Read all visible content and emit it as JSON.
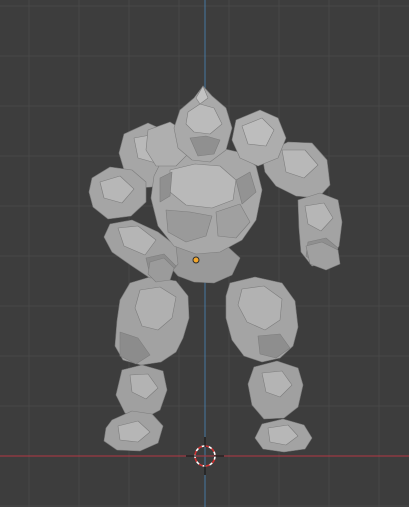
{
  "viewport": {
    "object_name": "rock-golem",
    "background": "#3d3d3d",
    "grid_color": "#484848",
    "x_axis_color": "#9c3a43",
    "z_axis_color": "#4577a1",
    "mesh_color": "#9d9d9d",
    "origin_color": "#f2a62b",
    "cursor_colors": [
      "#d03232",
      "#ffffff"
    ]
  }
}
